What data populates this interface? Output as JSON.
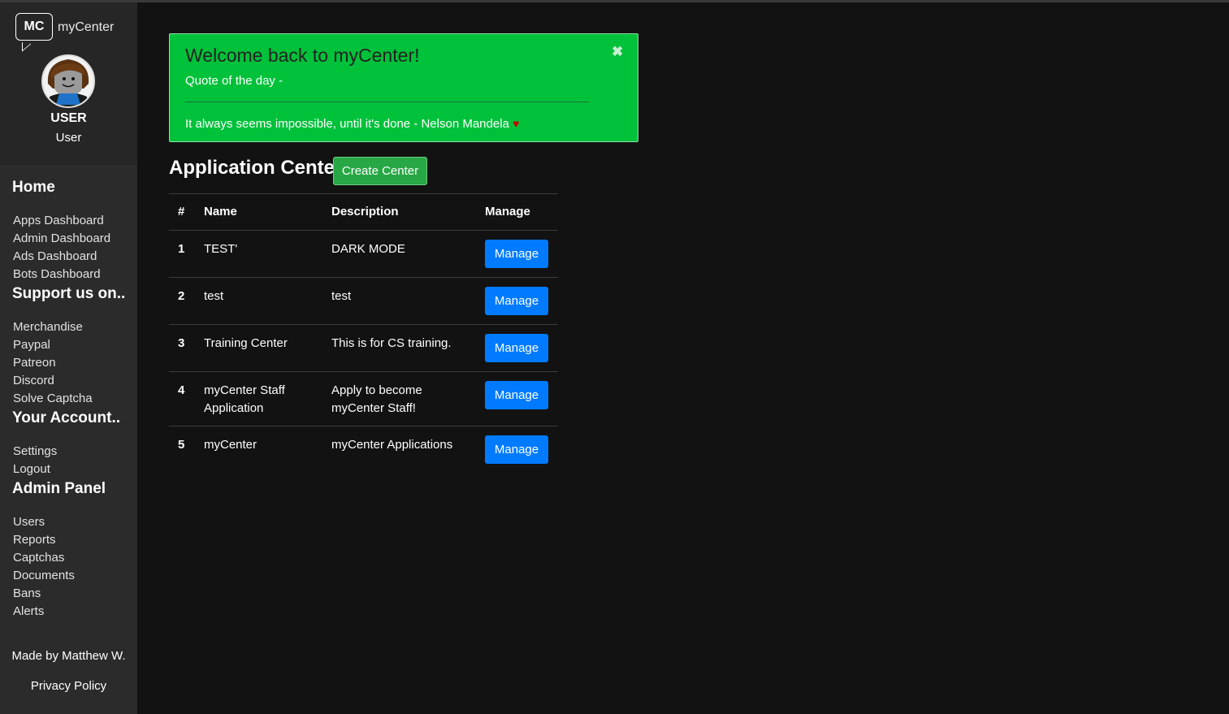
{
  "brand": {
    "logo_abbr": "MC",
    "logo_text": "myCenter"
  },
  "user": {
    "name": "USER",
    "role": "User"
  },
  "nav": {
    "home_heading": "Home",
    "home_items": [
      "Apps Dashboard",
      "Admin Dashboard",
      "Ads Dashboard",
      "Bots Dashboard"
    ],
    "support_heading": "Support us on..",
    "support_items": [
      "Merchandise",
      "Paypal",
      "Patreon",
      "Discord",
      "Solve Captcha"
    ],
    "account_heading": "Your Account..",
    "account_items": [
      "Settings",
      "Logout"
    ],
    "admin_heading": "Admin Panel",
    "admin_items": [
      "Users",
      "Reports",
      "Captchas",
      "Documents",
      "Bans",
      "Alerts"
    ]
  },
  "footer": {
    "credit": "Made by Matthew W.",
    "privacy": "Privacy Policy"
  },
  "alert": {
    "title": "Welcome back to myCenter!",
    "close_glyph": "✖",
    "subtitle": "Quote of the day -",
    "quote": "It always seems impossible, until it's done - Nelson Mandela",
    "heart_glyph": "♥"
  },
  "section": {
    "title": "Application Centers",
    "create_label": "Create Center"
  },
  "table": {
    "headers": {
      "num": "#",
      "name": "Name",
      "description": "Description",
      "manage": "Manage"
    },
    "manage_label": "Manage",
    "rows": [
      {
        "num": "1",
        "name": "TEST'",
        "description": "DARK MODE"
      },
      {
        "num": "2",
        "name": "test",
        "description": "test"
      },
      {
        "num": "3",
        "name": "Training Center",
        "description": "This is for CS training."
      },
      {
        "num": "4",
        "name": "myCenter Staff Application",
        "description": "Apply to become myCenter Staff!"
      },
      {
        "num": "5",
        "name": "myCenter",
        "description": "myCenter Applications"
      }
    ]
  },
  "colors": {
    "alert_bg": "#00c13a",
    "primary": "#007bff",
    "success": "#28a745",
    "sidebar": "#2b2b2b",
    "page_bg": "#121212"
  },
  "icons": {
    "close": "close-icon",
    "heart": "heart-icon"
  }
}
